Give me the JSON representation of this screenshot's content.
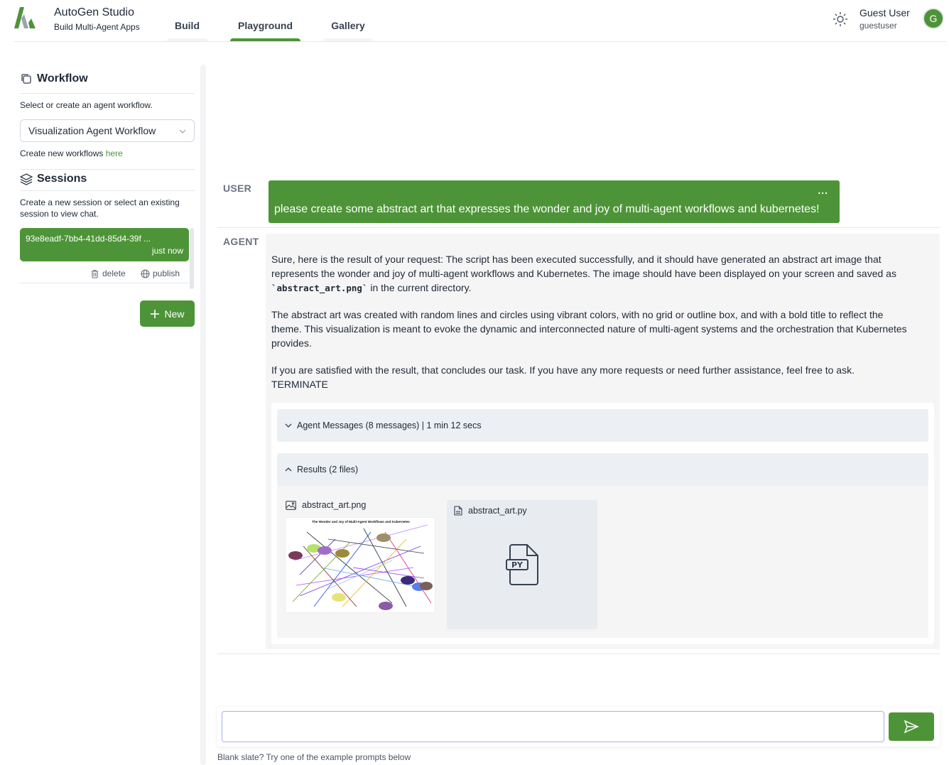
{
  "header": {
    "app_title": "AutoGen Studio",
    "app_subtitle": "Build Multi-Agent Apps",
    "tabs": [
      {
        "label": "Build",
        "active": false
      },
      {
        "label": "Playground",
        "active": true
      },
      {
        "label": "Gallery",
        "active": false
      }
    ],
    "user_name": "Guest User",
    "user_handle": "guestuser",
    "avatar_letter": "G",
    "theme_icon": "sun-icon"
  },
  "sidebar": {
    "workflow_title": "Workflow",
    "workflow_desc": "Select or create an agent workflow.",
    "workflow_selected": "Visualization Agent Workflow",
    "create_workflow_text": "Create new workflows ",
    "create_workflow_link": "here",
    "sessions_title": "Sessions",
    "sessions_desc": "Create a new session or select an existing session to view chat.",
    "session": {
      "id": "93e8eadf-7bb4-41dd-85d4-39f ...",
      "time": "just now",
      "delete_label": "delete",
      "publish_label": "publish"
    },
    "new_button": "New"
  },
  "chat": {
    "user_role": "USER",
    "user_message": "please create some abstract art that expresses the wonder and joy of multi-agent workflows and kubernetes!",
    "user_menu": "...",
    "agent_role": "AGENT",
    "agent_p1_before": "Sure, here is the result of your request: The script has been executed successfully, and it should have generated an abstract art image that represents the wonder and joy of multi-agent workflows and Kubernetes. The image should have been displayed on your screen and saved as ",
    "agent_p1_code": "`abstract_art.png`",
    "agent_p1_after": " in the current directory.",
    "agent_p2": "The abstract art was created with random lines and circles using vibrant colors, with no grid or outline box, and with a bold title to reflect the theme. This visualization is meant to evoke the dynamic and interconnected nature of multi-agent systems and the orchestration that Kubernetes provides.",
    "agent_p3": "If you are satisfied with the result, that concludes our task. If you have any more requests or need further assistance, feel free to ask.",
    "agent_p4": "TERMINATE",
    "agent_messages_label": "Agent Messages (8 messages) | 1 min 12 secs",
    "results_label": "Results (2 files)",
    "files": [
      {
        "name": "abstract_art.png",
        "icon": "image-icon"
      },
      {
        "name": "abstract_art.py",
        "icon": "file-icon"
      }
    ],
    "art_title": "The Wonder and Joy of Multi-Agent Workflows and Kubernetes",
    "py_badge": "PY"
  },
  "input": {
    "value": "",
    "placeholder": "",
    "hint": "Blank slate? Try one of the example prompts below"
  },
  "colors": {
    "accent": "#4d9438",
    "panel": "#f5f5f5",
    "collapse": "#eceff3"
  }
}
